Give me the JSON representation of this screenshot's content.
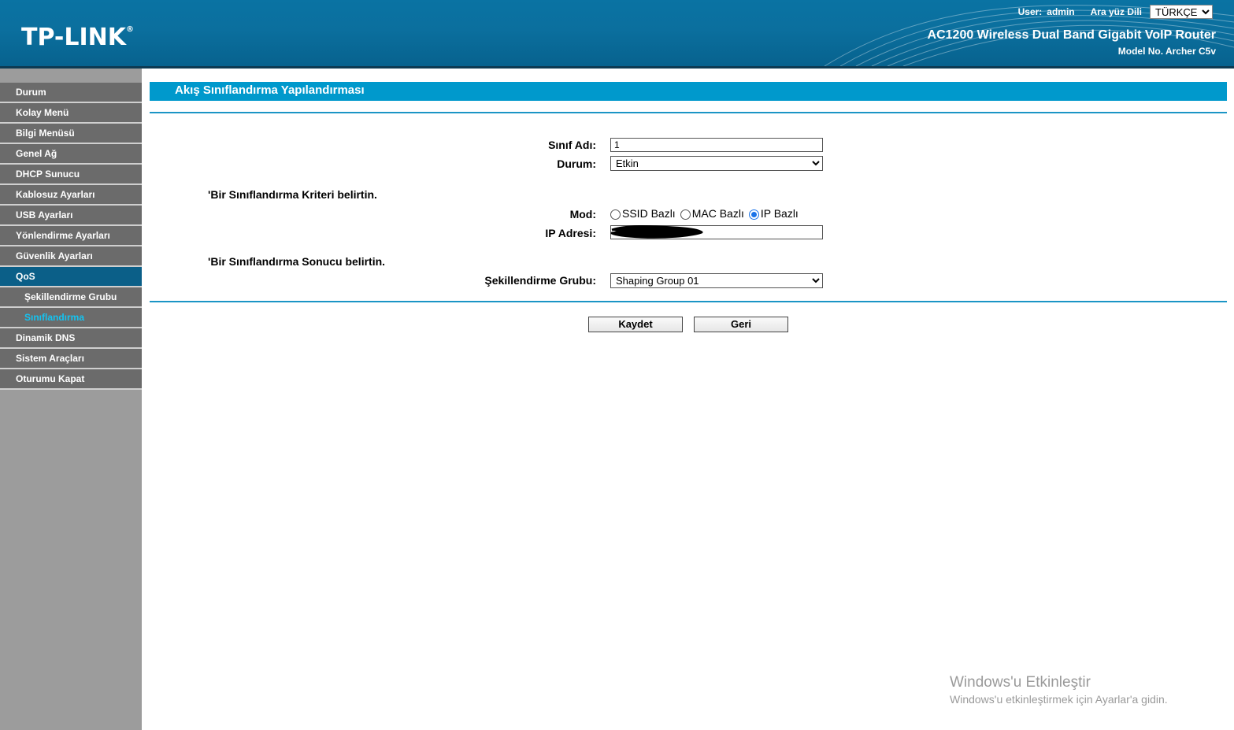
{
  "header": {
    "logo": "TP-LINK",
    "logo_mark": "®",
    "user_label": "User:",
    "user_name": "admin",
    "language_label": "Ara yüz Dili",
    "language_value": "TÜRKÇE",
    "product": "AC1200 Wireless Dual Band Gigabit VoIP Router",
    "model": "Model No. Archer C5v"
  },
  "sidebar": {
    "items": [
      {
        "label": "Durum"
      },
      {
        "label": "Kolay Menü"
      },
      {
        "label": "Bilgi Menüsü"
      },
      {
        "label": "Genel Ağ"
      },
      {
        "label": "DHCP Sunucu"
      },
      {
        "label": "Kablosuz Ayarları"
      },
      {
        "label": "USB Ayarları"
      },
      {
        "label": "Yönlendirme Ayarları"
      },
      {
        "label": "Güvenlik Ayarları"
      },
      {
        "label": "QoS"
      },
      {
        "label": "Şekillendirme Grubu"
      },
      {
        "label": "Sınıflandırma"
      },
      {
        "label": "Dinamik DNS"
      },
      {
        "label": "Sistem Araçları"
      },
      {
        "label": "Oturumu Kapat"
      }
    ]
  },
  "main": {
    "title": "Akış Sınıflandırma Yapılandırması",
    "class_name_label": "Sınıf Adı:",
    "class_name_value": "1",
    "status_label": "Durum:",
    "status_value": "Etkin",
    "criteria_note": "'Bir Sınıflandırma Kriteri belirtin.",
    "mode_label": "Mod:",
    "mode_options": [
      "SSID Bazlı",
      "MAC Bazlı",
      "IP Bazlı"
    ],
    "mode_selected": "IP Bazlı",
    "ip_label": "IP Adresi:",
    "result_note": "'Bir Sınıflandırma Sonucu belirtin.",
    "shaping_label": "Şekillendirme Grubu:",
    "shaping_value": "Shaping Group 01",
    "save_label": "Kaydet",
    "back_label": "Geri"
  },
  "watermark": {
    "title": "Windows'u Etkinleştir",
    "subtitle": "Windows'u etkinleştirmek için Ayarlar'a gidin."
  },
  "colors": {
    "header_blue": "#0a73a3",
    "title_bar": "#0099cc",
    "nav_bg": "#6b6b6b",
    "nav_active": "#0b5f88",
    "nav_current_text": "#13c4f2"
  }
}
